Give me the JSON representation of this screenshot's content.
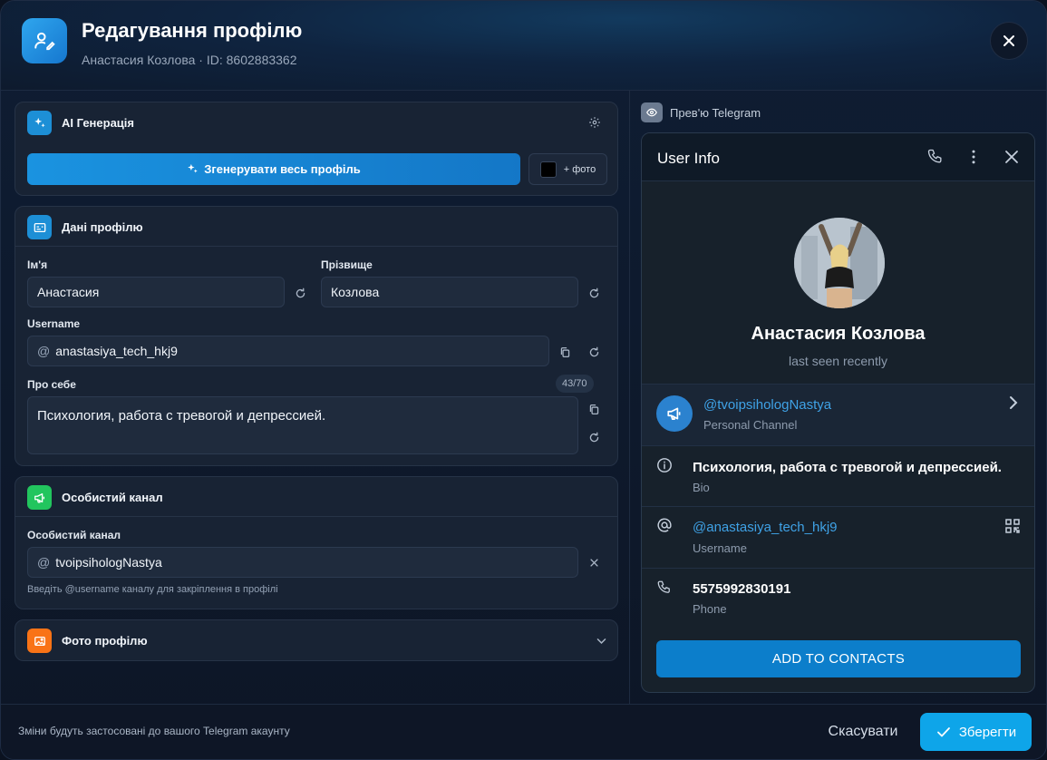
{
  "header": {
    "title": "Редагування профілю",
    "subtitle": "Анастасия Козлова · ID: 8602883362"
  },
  "ai": {
    "title": "AI Генерація",
    "generate_label": "Згенерувати весь профіль",
    "photo_label": "+ фото"
  },
  "profile": {
    "title": "Дані профілю",
    "first_name_label": "Ім'я",
    "first_name": "Анастасия",
    "last_name_label": "Прізвище",
    "last_name": "Козлова",
    "username_label": "Username",
    "username_prefix": "@",
    "username": "anastasiya_tech_hkj9",
    "bio_label": "Про себе",
    "bio_counter": "43/70",
    "bio": "Психология, работа с тревогой и депрессией."
  },
  "channel": {
    "title": "Особистий канал",
    "field_label": "Особистий канал",
    "prefix": "@",
    "value": "tvoipsihologNastya",
    "hint": "Введіть @username каналу для закріплення в профілі"
  },
  "photos": {
    "title": "Фото профілю"
  },
  "preview": {
    "label": "Прев'ю Telegram",
    "header_title": "User Info",
    "name": "Анастасия Козлова",
    "status": "last seen recently",
    "channel_link": "@tvoipsihologNastya",
    "channel_sub": "Personal Channel",
    "bio": "Психология, работа с тревогой и депрессией.",
    "bio_sub": "Bio",
    "username_link": "@anastasiya_tech_hkj9",
    "username_sub": "Username",
    "phone": "5575992830191",
    "phone_sub": "Phone",
    "add_button": "ADD TO CONTACTS"
  },
  "footer": {
    "note": "Зміни будуть застосовані до вашого Telegram акаунту",
    "cancel": "Скасувати",
    "save": "Зберегти"
  },
  "colors": {
    "accent": "#0ea5e9",
    "tg_link": "#3fa2e6",
    "channel_icon": "#22c55e",
    "photo_icon": "#f97316"
  }
}
